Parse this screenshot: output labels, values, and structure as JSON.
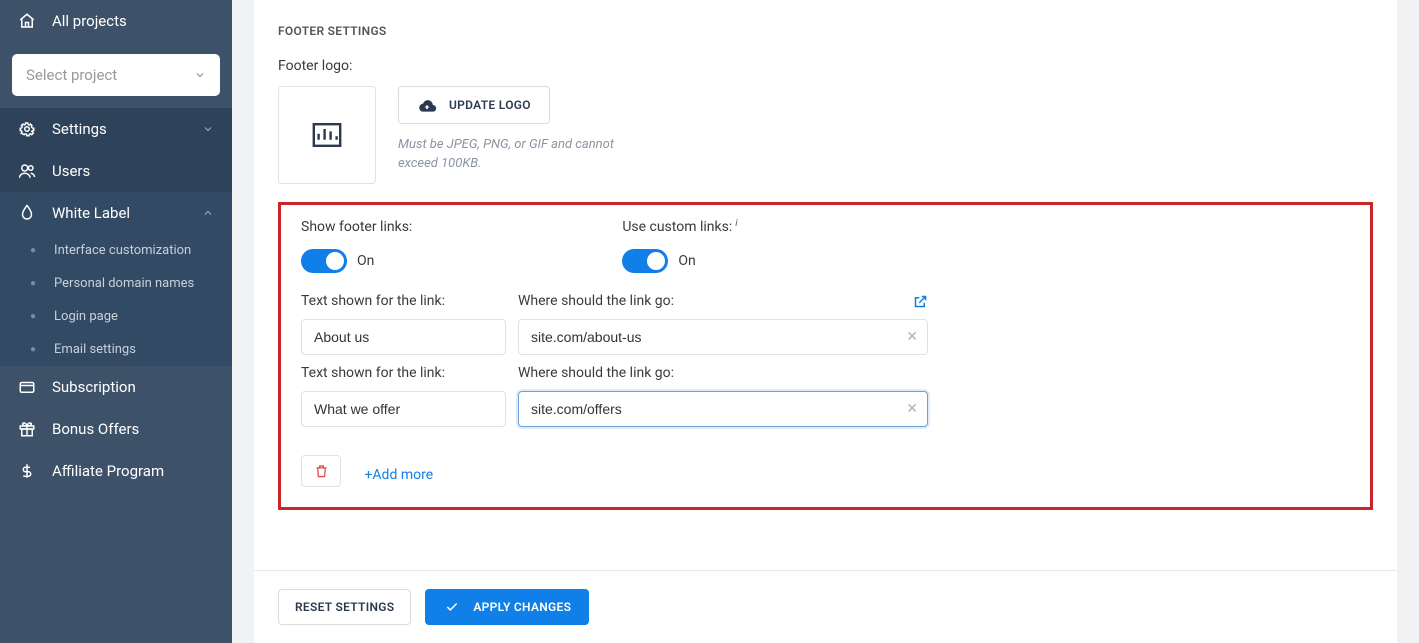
{
  "sidebar": {
    "all_projects": "All projects",
    "select_placeholder": "Select project",
    "settings": "Settings",
    "users": "Users",
    "white_label": "White Label",
    "sub": {
      "interface": "Interface customization",
      "domains": "Personal domain names",
      "login": "Login page",
      "email": "Email settings"
    },
    "subscription": "Subscription",
    "bonus": "Bonus Offers",
    "affiliate": "Affiliate Program"
  },
  "main": {
    "section_title": "FOOTER SETTINGS",
    "footer_logo_label": "Footer logo:",
    "update_logo": "UPDATE LOGO",
    "logo_hint": "Must be JPEG, PNG, or GIF and cannot exceed 100KB.",
    "show_footer_links_label": "Show footer links:",
    "use_custom_links_label": "Use custom links:",
    "on": "On",
    "text_shown_label": "Text shown for the link:",
    "where_link_label": "Where should the link go:",
    "links": [
      {
        "text": "About us",
        "url": "site.com/about-us"
      },
      {
        "text": "What we offer",
        "url": "site.com/offers"
      }
    ],
    "add_more": "+Add more",
    "reset": "RESET SETTINGS",
    "apply": "APPLY CHANGES"
  }
}
